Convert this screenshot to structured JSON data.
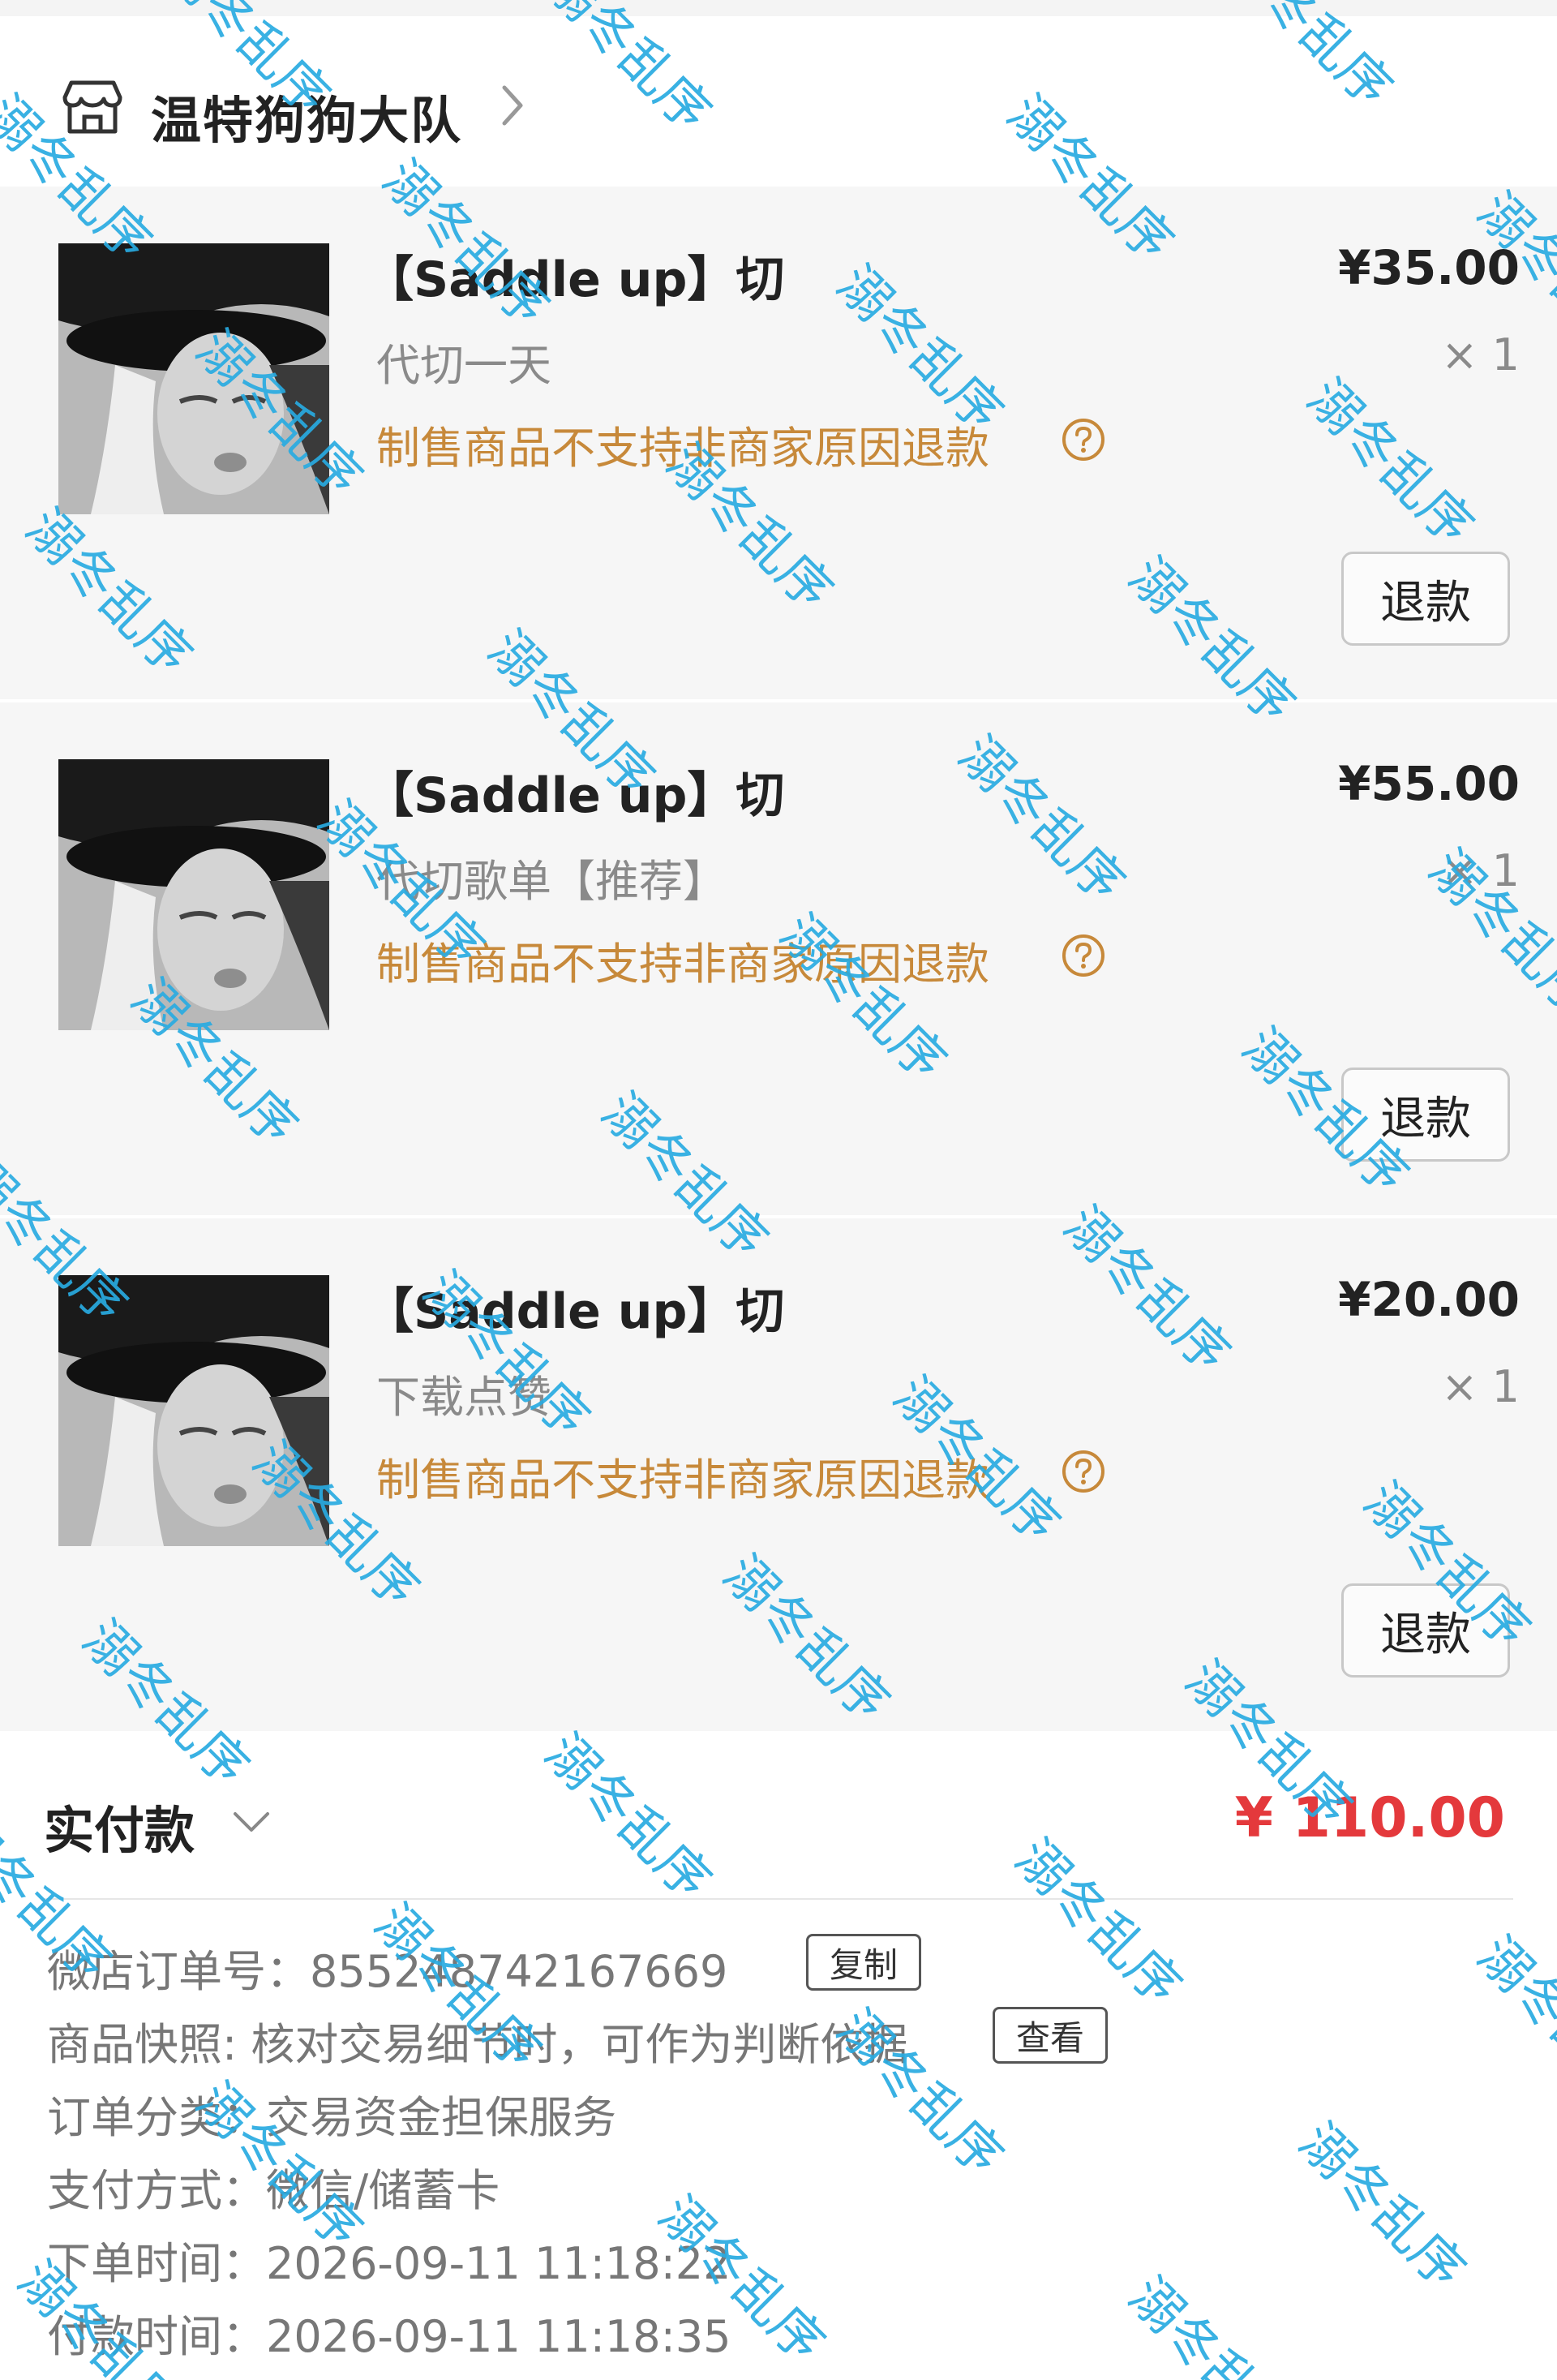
{
  "shop": {
    "name": "温特狗狗大队",
    "icon": "store-icon",
    "chevron_icon": "chevron-right-icon"
  },
  "items": [
    {
      "title": "【Saddle up】切",
      "variant": "代切一天",
      "price": "¥35.00",
      "quantity": "× 1",
      "refund_notice": "制售商品不支持非商家原因退款",
      "refund_button": "退款"
    },
    {
      "title": "【Saddle up】切",
      "variant": "代切歌单【推荐】",
      "price": "¥55.00",
      "quantity": "× 1",
      "refund_notice": "制售商品不支持非商家原因退款",
      "refund_button": "退款"
    },
    {
      "title": "【Saddle up】切",
      "variant": "下载点赞",
      "price": "¥20.00",
      "quantity": "× 1",
      "refund_notice": "制售商品不支持非商家原因退款",
      "refund_button": "退款"
    }
  ],
  "payment": {
    "label": "实付款",
    "amount": "¥ 110.00",
    "chevron_icon": "chevron-down-icon"
  },
  "order_info": {
    "order_number": "微店订单号：855248742167669",
    "copy_button": "复制",
    "snapshot": "商品快照: 核对交易细节时，可作为判断依据",
    "view_button": "查看",
    "category": "订单分类：交易资金担保服务",
    "payment_method": "支付方式：微信/储蓄卡",
    "created_time": "下单时间：2026-09-11 11:18:22",
    "paid_time": "付款时间：2026-09-11 11:18:35"
  },
  "watermark": {
    "text": "溺冬乱序"
  },
  "colors": {
    "price_red": "#e4393c",
    "notice_orange": "#c7893a",
    "card_bg": "#f6f6f6",
    "watermark_blue": "#28aae1"
  }
}
